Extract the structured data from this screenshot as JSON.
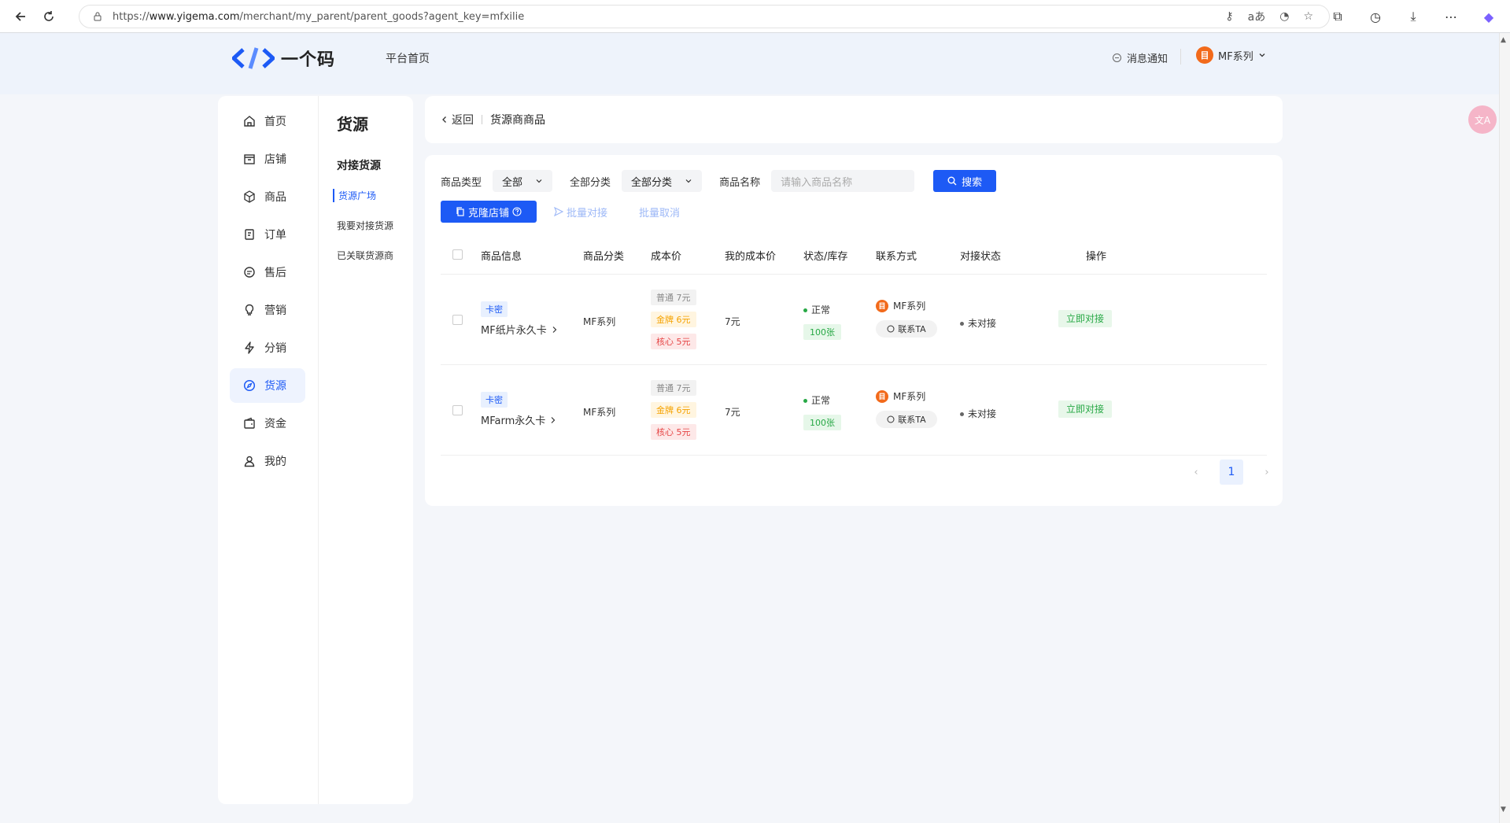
{
  "browser": {
    "url_prefix": "https://",
    "url_domain": "www.yigema.com",
    "url_path": "/merchant/my_parent/parent_goods?agent_key=mfxilie"
  },
  "header": {
    "logo_text": "一个码",
    "platform_link": "平台首页",
    "notify": "消息通知",
    "user": "MF系列",
    "user_initial": "目"
  },
  "sidebar": {
    "items": [
      {
        "label": "首页",
        "icon": "home-icon"
      },
      {
        "label": "店铺",
        "icon": "store-icon"
      },
      {
        "label": "商品",
        "icon": "box-icon"
      },
      {
        "label": "订单",
        "icon": "order-icon"
      },
      {
        "label": "售后",
        "icon": "chat-icon"
      },
      {
        "label": "营销",
        "icon": "bulb-icon"
      },
      {
        "label": "分销",
        "icon": "bolt-icon"
      },
      {
        "label": "货源",
        "icon": "compass-icon"
      },
      {
        "label": "资金",
        "icon": "wallet-icon"
      },
      {
        "label": "我的",
        "icon": "user-icon"
      }
    ],
    "active": "货源"
  },
  "subnav": {
    "title": "货源",
    "group": "对接货源",
    "items": [
      "货源广场",
      "我要对接货源",
      "已关联货源商"
    ],
    "active": "货源广场"
  },
  "breadcrumb": {
    "back": "返回",
    "title": "货源商商品"
  },
  "filters": {
    "type_label": "商品类型",
    "type_value": "全部",
    "category_label": "全部分类",
    "category_value": "全部分类",
    "name_label": "商品名称",
    "name_placeholder": "请输入商品名称",
    "search_button": "搜索"
  },
  "actions": {
    "clone": "克隆店铺",
    "batch_connect": "批量对接",
    "batch_cancel": "批量取消"
  },
  "table": {
    "headers": [
      "商品信息",
      "商品分类",
      "成本价",
      "我的成本价",
      "状态/库存",
      "联系方式",
      "对接状态",
      "操作"
    ],
    "rows": [
      {
        "tag": "卡密",
        "name": "MF纸片永久卡",
        "category": "MF系列",
        "price_normal": "普通 7元",
        "price_gold": "金牌 6元",
        "price_core": "核心 5元",
        "my_cost": "7元",
        "status": "正常",
        "stock": "100张",
        "contact_name": "MF系列",
        "contact_btn": "联系TA",
        "connect_status": "未对接",
        "action": "立即对接"
      },
      {
        "tag": "卡密",
        "name": "MFarm永久卡",
        "category": "MF系列",
        "price_normal": "普通 7元",
        "price_gold": "金牌 6元",
        "price_core": "核心 5元",
        "my_cost": "7元",
        "status": "正常",
        "stock": "100张",
        "contact_name": "MF系列",
        "contact_btn": "联系TA",
        "connect_status": "未对接",
        "action": "立即对接"
      }
    ]
  },
  "pagination": {
    "current": "1"
  },
  "colors": {
    "primary": "#1d5af5",
    "success": "#27a845",
    "gold": "#f5a200",
    "danger": "#e64545"
  }
}
